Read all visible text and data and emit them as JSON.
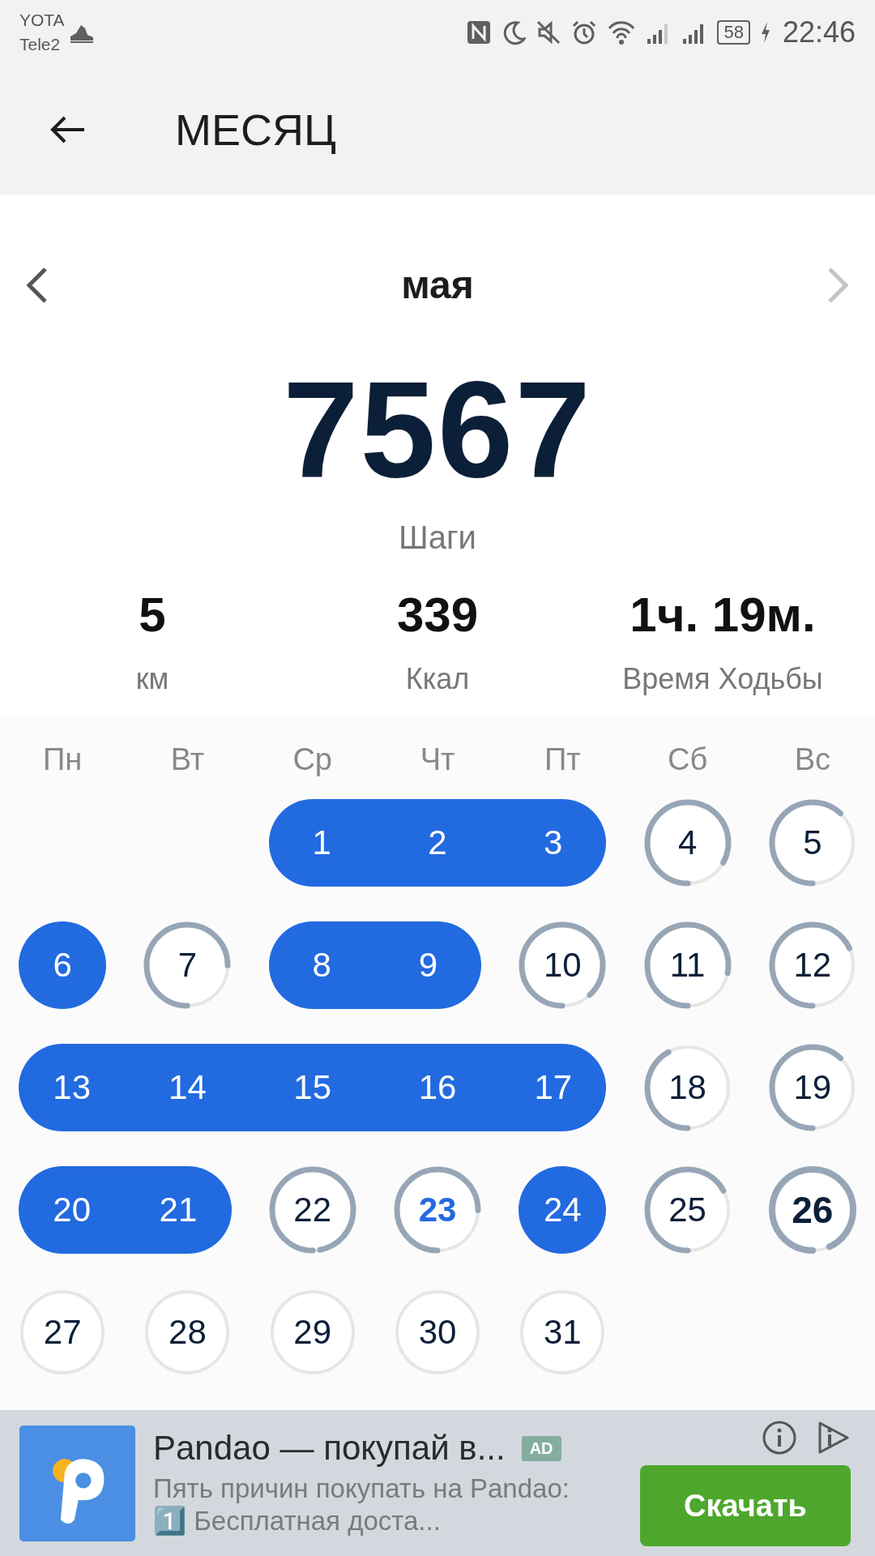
{
  "status_bar": {
    "carriers": [
      "YOTA",
      "Tele2"
    ],
    "battery": "58",
    "time": "22:46"
  },
  "app_bar": {
    "title": "МЕСЯЦ"
  },
  "month_nav": {
    "month": "мая"
  },
  "summary": {
    "steps": "7567",
    "steps_label": "Шаги"
  },
  "stats": [
    {
      "value": "5",
      "label": "км"
    },
    {
      "value": "339",
      "label": "Ккал"
    },
    {
      "value": "1ч. 19м.",
      "label": "Время Ходьбы"
    }
  ],
  "weekdays": [
    "Пн",
    "Вт",
    "Ср",
    "Чт",
    "Пт",
    "Сб",
    "Вс"
  ],
  "days": [
    {
      "label": "1",
      "kind": "goal",
      "today": false,
      "selected": false
    },
    {
      "label": "2",
      "kind": "goal",
      "today": false,
      "selected": false
    },
    {
      "label": "3",
      "kind": "goal",
      "today": false,
      "selected": false
    },
    {
      "label": "4",
      "kind": "ring",
      "today": false,
      "selected": false
    },
    {
      "label": "5",
      "kind": "ring",
      "today": false,
      "selected": false
    },
    {
      "label": "6",
      "kind": "goal",
      "today": false,
      "selected": false
    },
    {
      "label": "7",
      "kind": "ring",
      "today": false,
      "selected": false
    },
    {
      "label": "8",
      "kind": "goal",
      "today": false,
      "selected": false
    },
    {
      "label": "9",
      "kind": "goal",
      "today": false,
      "selected": false
    },
    {
      "label": "10",
      "kind": "ring",
      "today": false,
      "selected": false
    },
    {
      "label": "11",
      "kind": "ring",
      "today": false,
      "selected": false
    },
    {
      "label": "12",
      "kind": "ring",
      "today": false,
      "selected": false
    },
    {
      "label": "13",
      "kind": "goal",
      "today": false,
      "selected": false
    },
    {
      "label": "14",
      "kind": "goal",
      "today": false,
      "selected": false
    },
    {
      "label": "15",
      "kind": "goal",
      "today": false,
      "selected": false
    },
    {
      "label": "16",
      "kind": "goal",
      "today": false,
      "selected": false
    },
    {
      "label": "17",
      "kind": "goal",
      "today": false,
      "selected": false
    },
    {
      "label": "18",
      "kind": "ring",
      "today": false,
      "selected": false
    },
    {
      "label": "19",
      "kind": "ring",
      "today": false,
      "selected": false
    },
    {
      "label": "20",
      "kind": "goal",
      "today": false,
      "selected": false
    },
    {
      "label": "21",
      "kind": "goal",
      "today": false,
      "selected": false
    },
    {
      "label": "22",
      "kind": "ring",
      "today": false,
      "selected": false
    },
    {
      "label": "23",
      "kind": "ring",
      "today": true,
      "selected": false
    },
    {
      "label": "24",
      "kind": "goal",
      "today": false,
      "selected": false
    },
    {
      "label": "25",
      "kind": "ring",
      "today": false,
      "selected": false
    },
    {
      "label": "26",
      "kind": "ring",
      "today": false,
      "selected": true
    },
    {
      "label": "27",
      "kind": "future",
      "today": false,
      "selected": false
    },
    {
      "label": "28",
      "kind": "future",
      "today": false,
      "selected": false
    },
    {
      "label": "29",
      "kind": "future",
      "today": false,
      "selected": false
    },
    {
      "label": "30",
      "kind": "future",
      "today": false,
      "selected": false
    },
    {
      "label": "31",
      "kind": "future",
      "today": false,
      "selected": false
    }
  ],
  "ad": {
    "title": "Pandao — покупай в...",
    "badge": "AD",
    "text": "Пять причин покупать на Pandao: 1️⃣ Бесплатная доста...",
    "button": "Скачать"
  }
}
